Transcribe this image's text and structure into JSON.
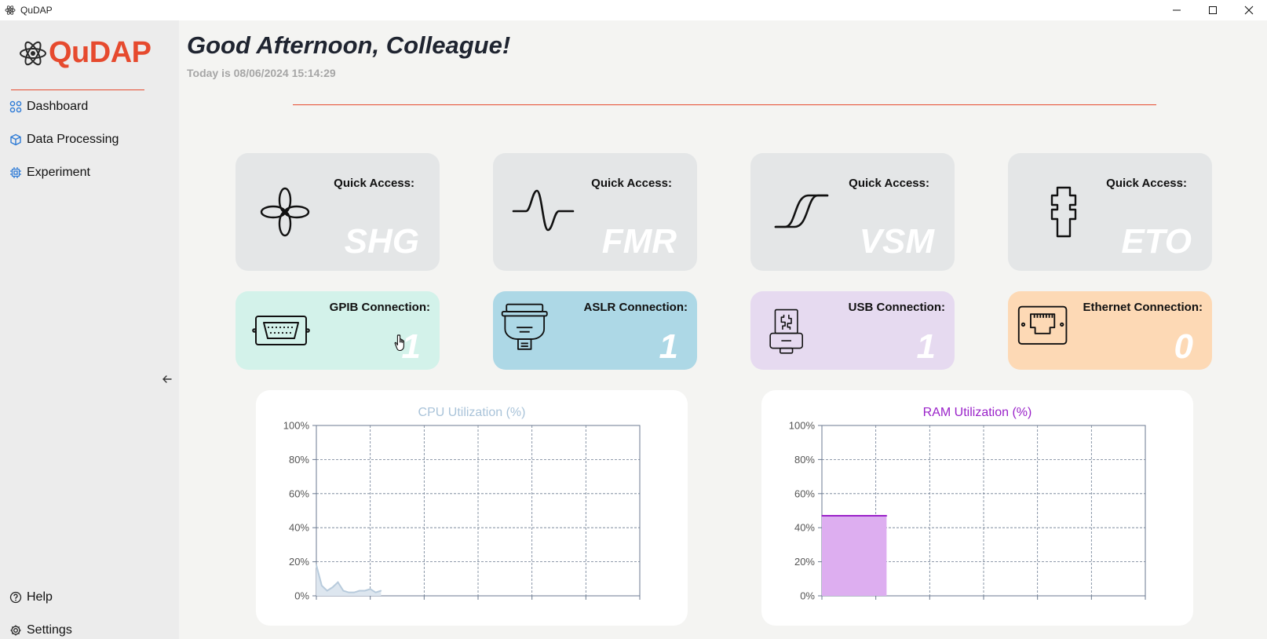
{
  "window": {
    "title": "QuDAP"
  },
  "sidebar": {
    "logo_text": "QuDAP",
    "items": [
      {
        "label": "Dashboard",
        "icon": "dashboard-icon"
      },
      {
        "label": "Data Processing",
        "icon": "cube-icon"
      },
      {
        "label": "Experiment",
        "icon": "chip-icon"
      }
    ],
    "bottom_items": [
      {
        "label": "Help",
        "icon": "help-icon"
      },
      {
        "label": "Settings",
        "icon": "gear-icon"
      }
    ]
  },
  "header": {
    "greeting": "Good Afternoon, Colleague!",
    "date_text": "Today is 08/06/2024 15:14:29"
  },
  "quick_access": [
    {
      "label": "Quick Access:",
      "name": "SHG",
      "icon": "clover-icon"
    },
    {
      "label": "Quick Access:",
      "name": "FMR",
      "icon": "wave-icon"
    },
    {
      "label": "Quick Access:",
      "name": "VSM",
      "icon": "hysteresis-icon"
    },
    {
      "label": "Quick Access:",
      "name": "ETO",
      "icon": "cross-icon"
    }
  ],
  "connections": [
    {
      "label": "GPIB Connection:",
      "count": "1",
      "icon": "gpib-port-icon",
      "color": "#d3f2ea"
    },
    {
      "label": "ASLR Connection:",
      "count": "1",
      "icon": "serial-port-icon",
      "color": "#add8e6"
    },
    {
      "label": "USB Connection:",
      "count": "1",
      "icon": "usb-icon",
      "color": "#e6daf0"
    },
    {
      "label": "Ethernet Connection:",
      "count": "0",
      "icon": "ethernet-icon",
      "color": "#fdd9b5"
    }
  ],
  "chart_data": [
    {
      "type": "area",
      "title": "CPU Utilization (%)",
      "title_color": "#a9c3d9",
      "fill_color": "#dde6ef",
      "line_color": "#b8cbdc",
      "ylim": [
        0,
        100
      ],
      "xlim": [
        0,
        60
      ],
      "y_ticks": [
        "0%",
        "20%",
        "40%",
        "60%",
        "80%",
        "100%"
      ],
      "x": [
        0,
        1,
        2,
        3,
        4,
        5,
        6,
        7,
        8,
        9,
        10,
        11,
        12
      ],
      "values": [
        18,
        6,
        3,
        5,
        8,
        3,
        2,
        2,
        3,
        3,
        4,
        2,
        3
      ],
      "grid": true
    },
    {
      "type": "area",
      "title": "RAM Utilization (%)",
      "title_color": "#9a22c9",
      "fill_color": "#ddaef0",
      "line_color": "#9a22c9",
      "ylim": [
        0,
        100
      ],
      "xlim": [
        0,
        60
      ],
      "y_ticks": [
        "0%",
        "20%",
        "40%",
        "60%",
        "80%",
        "100%"
      ],
      "x": [
        0,
        1,
        2,
        3,
        4,
        5,
        6,
        7,
        8,
        9,
        10,
        11,
        12
      ],
      "values": [
        47,
        47,
        47,
        47,
        47,
        47,
        47,
        47,
        47,
        47,
        47,
        47,
        47
      ],
      "grid": true
    }
  ]
}
